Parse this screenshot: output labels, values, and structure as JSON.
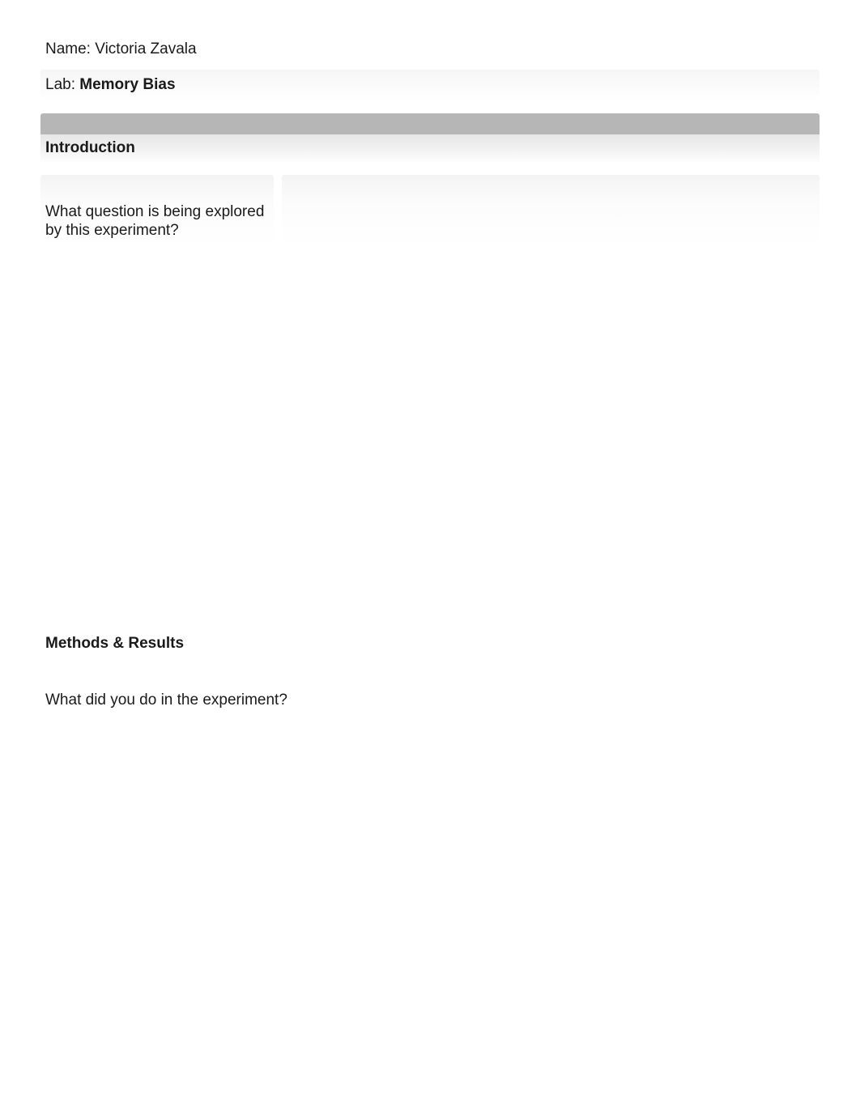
{
  "header": {
    "name_label": "Name: ",
    "name_value": "Victoria Zavala",
    "lab_label": "Lab:  ",
    "lab_value": "Memory Bias"
  },
  "sections": {
    "introduction": {
      "heading": "Introduction",
      "question": "What question is being explored by this experiment?"
    },
    "methods": {
      "heading": "Methods & Results",
      "question": "What did you do in the experiment?"
    }
  }
}
